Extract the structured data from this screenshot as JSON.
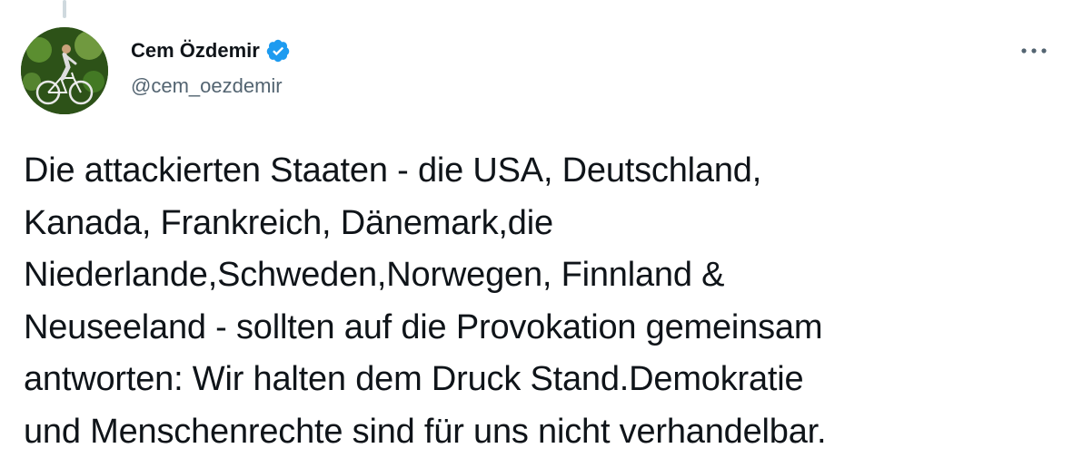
{
  "tweet": {
    "author": {
      "display_name": "Cem Özdemir",
      "handle": "@cem_oezdemir",
      "verified": true,
      "avatar_icon": "avatar-cyclist-photo"
    },
    "text": "Die attackierten Staaten - die USA, Deutschland,\nKanada, Frankreich, Dänemark,die\nNiederlande,Schweden,Norwegen, Finnland &\nNeuseeland - sollten auf die Provokation gemeinsam\nantworten: Wir halten dem Druck Stand.Demokratie\nund Menschenrechte sind für uns nicht verhandelbar.",
    "more_options_icon": "more-horizontal-icon"
  },
  "colors": {
    "verified": "#1d9bf0",
    "handle": "#536471",
    "text": "#0f1419",
    "thread_line": "#cfd9de"
  }
}
